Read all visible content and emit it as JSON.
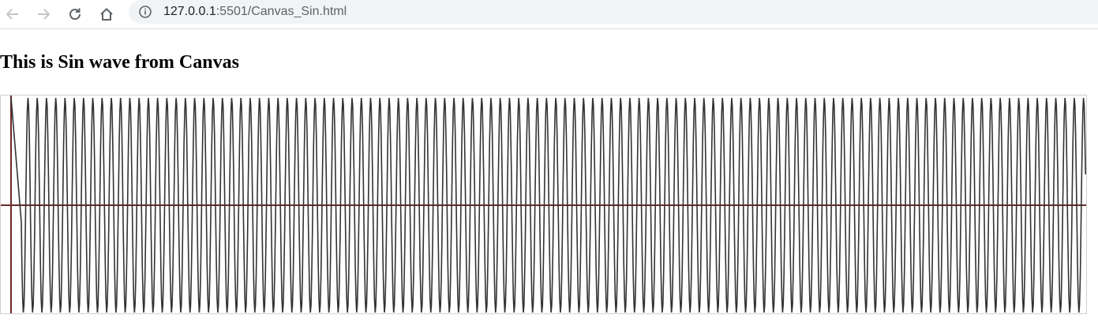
{
  "browser": {
    "url_host": "127.0.0.1",
    "url_rest": ":5501/Canvas_Sin.html",
    "icons": [
      "back-arrow-icon",
      "forward-arrow-icon",
      "reload-icon",
      "home-icon",
      "info-icon"
    ]
  },
  "page": {
    "heading": "This is Sin wave from Canvas"
  },
  "canvas": {
    "wave_color": "#333333",
    "axis_color": "#6b2a2a",
    "cycles": 115,
    "amplitude_fraction": 0.98
  }
}
